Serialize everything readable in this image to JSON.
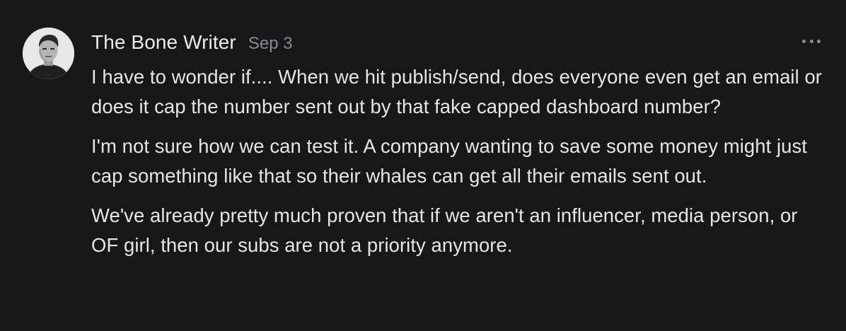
{
  "comment": {
    "author": "The Bone Writer",
    "date": "Sep 3",
    "more_icon": "more-horizontal-icon",
    "paragraphs": [
      "I have to wonder if.... When we hit publish/send, does everyone even get an email or does it cap the number sent out by that fake capped dashboard number?",
      "I'm not sure how we can test it. A company wanting to save some money might just cap something like that so their whales can get all their emails sent out.",
      "We've already pretty much proven that if we aren't an influencer, media person, or OF girl, then our subs are not a priority anymore."
    ]
  },
  "colors": {
    "background": "#17171a",
    "text": "#e6e6e8",
    "muted": "#8a8a8f"
  }
}
